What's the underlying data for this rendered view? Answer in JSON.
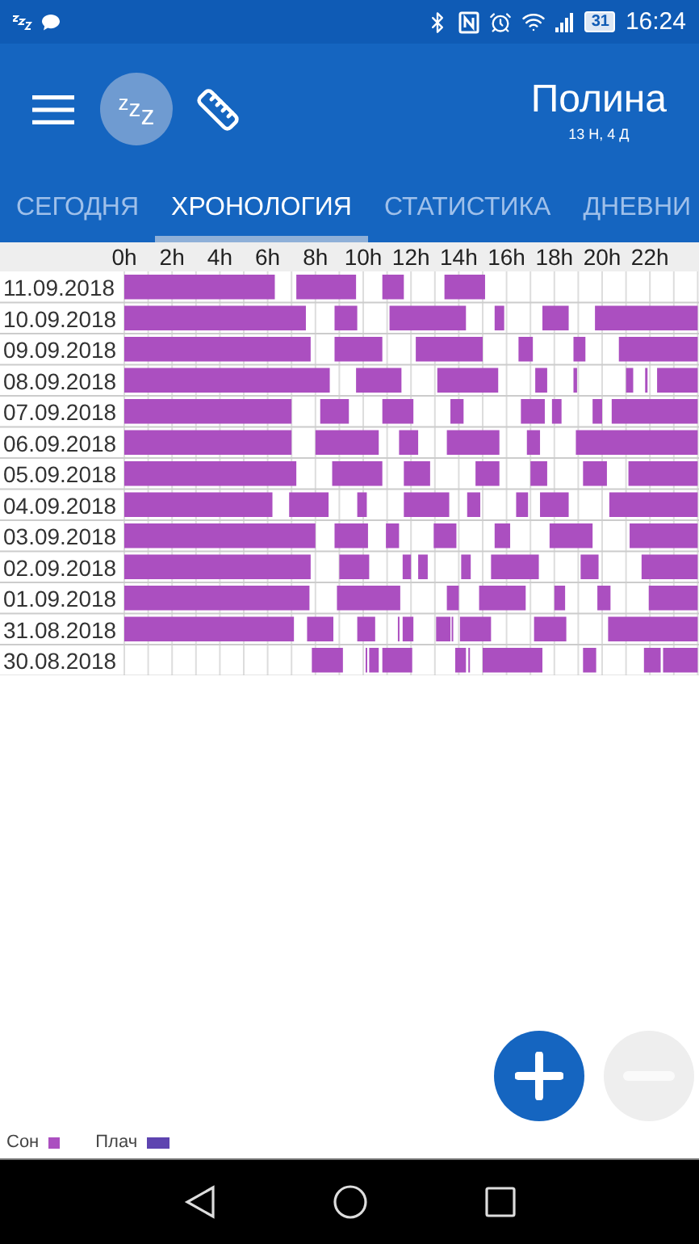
{
  "status_bar": {
    "battery": "31",
    "time": "16:24"
  },
  "app_bar": {
    "avatar_text": "zzz",
    "title": "Полина",
    "subtitle": "13 Н, 4 Д"
  },
  "tabs": [
    {
      "label": "СЕГОДНЯ",
      "selected": false
    },
    {
      "label": "ХРОНОЛОГИЯ",
      "selected": true
    },
    {
      "label": "СТАТИСТИКА",
      "selected": false
    },
    {
      "label": "ДНЕВНИ",
      "selected": false
    }
  ],
  "timeline": {
    "hour_labels": [
      "0h",
      "2h",
      "4h",
      "6h",
      "8h",
      "10h",
      "12h",
      "14h",
      "16h",
      "18h",
      "20h",
      "22h"
    ],
    "dates": [
      "11.09.2018",
      "10.09.2018",
      "09.09.2018",
      "08.09.2018",
      "07.09.2018",
      "06.09.2018",
      "05.09.2018",
      "04.09.2018",
      "03.09.2018",
      "02.09.2018",
      "01.09.2018",
      "31.08.2018",
      "30.08.2018"
    ]
  },
  "fabs": [
    {
      "kind": "add",
      "disabled": false
    },
    {
      "kind": "remove",
      "disabled": true
    }
  ],
  "legend": [
    {
      "label": "Сон",
      "color": "#ab4fc0"
    },
    {
      "label": "Плач",
      "color": "#5e44b0"
    }
  ]
}
